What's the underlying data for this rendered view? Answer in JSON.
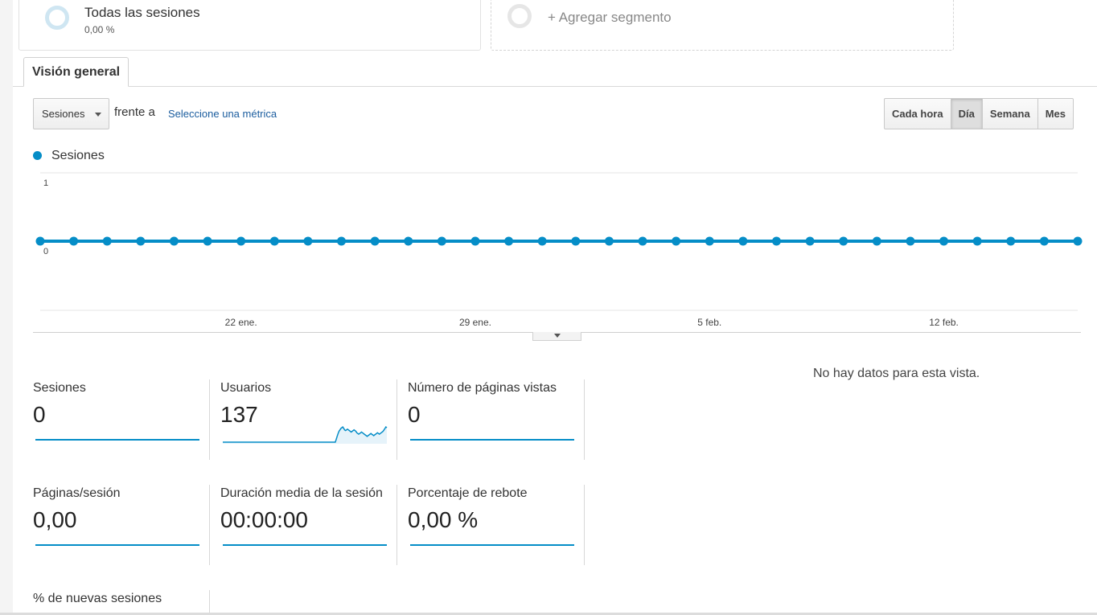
{
  "segments": {
    "active": {
      "title": "Todas las sesiones",
      "percent": "0,00 %"
    },
    "add_label": "+ Agregar segmento"
  },
  "tabs": [
    {
      "label": "Visión general"
    }
  ],
  "controls": {
    "metric_select": "Sesiones",
    "versus": "frente a",
    "select_metric_link": "Seleccione una métrica",
    "granularity": [
      {
        "label": "Cada hora",
        "selected": false
      },
      {
        "label": "Día",
        "selected": true
      },
      {
        "label": "Semana",
        "selected": false
      },
      {
        "label": "Mes",
        "selected": false
      }
    ]
  },
  "chart_data": {
    "type": "line",
    "series": [
      {
        "name": "Sesiones",
        "color": "#058dc7",
        "values": [
          0,
          0,
          0,
          0,
          0,
          0,
          0,
          0,
          0,
          0,
          0,
          0,
          0,
          0,
          0,
          0,
          0,
          0,
          0,
          0,
          0,
          0,
          0,
          0,
          0,
          0,
          0,
          0,
          0,
          0,
          0,
          0
        ]
      }
    ],
    "y_ticks": [
      "1",
      "0"
    ],
    "ylim": [
      0,
      1
    ],
    "x_tick_labels": [
      {
        "label": "22 ene.",
        "index": 6
      },
      {
        "label": "29 ene.",
        "index": 13
      },
      {
        "label": "5 feb.",
        "index": 20
      },
      {
        "label": "12 feb.",
        "index": 27
      }
    ],
    "grid": true
  },
  "metrics": [
    {
      "label": "Sesiones",
      "value": "0",
      "spark": "flat"
    },
    {
      "label": "Usuarios",
      "value": "137",
      "spark": "data",
      "spark_values": [
        0,
        0,
        0,
        0,
        0,
        0,
        0,
        0,
        0,
        0,
        0,
        0,
        0,
        0,
        0,
        0,
        0,
        0,
        0,
        0,
        0,
        0,
        0,
        0,
        0,
        0,
        0,
        0,
        0,
        0,
        0,
        0,
        0,
        0,
        0,
        0,
        0,
        0,
        0,
        0,
        0,
        0,
        0,
        0,
        0,
        0,
        0,
        0,
        0,
        0,
        0,
        0,
        0,
        0,
        0,
        0,
        0,
        0,
        0,
        0,
        0,
        0,
        0,
        0,
        0,
        0,
        0,
        0,
        0,
        0,
        0,
        0,
        0,
        0,
        0,
        0,
        0,
        0,
        0,
        0,
        0,
        0,
        0,
        0,
        0,
        0,
        0,
        0,
        0,
        0,
        0,
        0,
        0,
        0,
        0,
        0,
        0,
        0,
        0,
        0,
        0,
        0,
        0,
        0,
        0,
        0,
        0,
        0,
        0,
        0,
        0,
        0,
        0,
        0,
        0,
        0,
        0,
        0,
        0,
        0,
        0,
        4,
        8,
        12,
        15,
        17,
        19,
        20,
        21,
        19,
        17,
        16,
        17,
        18,
        17,
        16,
        15,
        14,
        15,
        16,
        17,
        16,
        15,
        13,
        12,
        11,
        12,
        13,
        14,
        13,
        12,
        11,
        10,
        9,
        8,
        9,
        10,
        11,
        12,
        11,
        10,
        9,
        10,
        11,
        12,
        13,
        12,
        11,
        12,
        13,
        14,
        15,
        17,
        19,
        21,
        20
      ]
    },
    {
      "label": "Número de páginas vistas",
      "value": "0",
      "spark": "flat"
    },
    {
      "label": "Páginas/sesión",
      "value": "0,00",
      "spark": "flat"
    },
    {
      "label": "Duración media de la sesión",
      "value": "00:00:00",
      "spark": "flat"
    },
    {
      "label": "Porcentaje de rebote",
      "value": "0,00 %",
      "spark": "flat"
    },
    {
      "label": "% de nuevas sesiones",
      "value": "",
      "spark": "none"
    }
  ],
  "no_data_message": "No hay datos para esta vista."
}
